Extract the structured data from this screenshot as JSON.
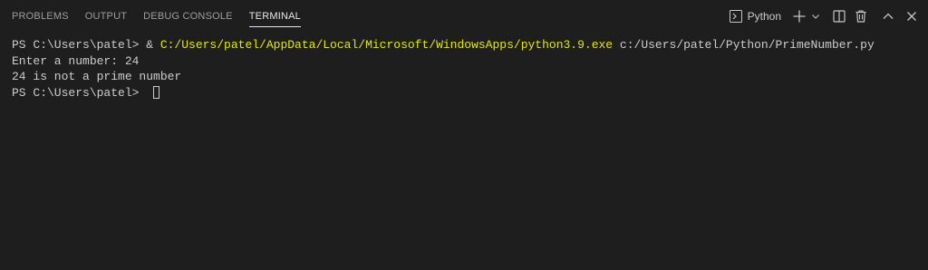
{
  "tabs": [
    {
      "label": "PROBLEMS"
    },
    {
      "label": "OUTPUT"
    },
    {
      "label": "DEBUG CONSOLE"
    },
    {
      "label": "TERMINAL"
    }
  ],
  "active_tab": "TERMINAL",
  "toolbar": {
    "terminal_profile": "Python",
    "icons": [
      "terminal-icon",
      "plus-icon",
      "chevron-down-icon",
      "split-icon",
      "trash-icon",
      "chevron-up-icon",
      "close-icon"
    ]
  },
  "terminal": {
    "line1": {
      "prompt": "PS C:\\Users\\patel> & ",
      "executable": "C:/Users/patel/AppData/Local/Microsoft/WindowsApps/python3.9.exe",
      "args": " c:/Users/patel/Python/PrimeNumber.py"
    },
    "line2": "Enter a number: 24",
    "line3": "24 is not a prime number",
    "line4_prompt": "PS C:\\Users\\patel> "
  },
  "colors": {
    "background": "#1e1e1e",
    "text": "#cccccc",
    "executable": "#e5e510",
    "inactive_tab": "#9d9d9d",
    "active_tab": "#e7e7e7"
  }
}
